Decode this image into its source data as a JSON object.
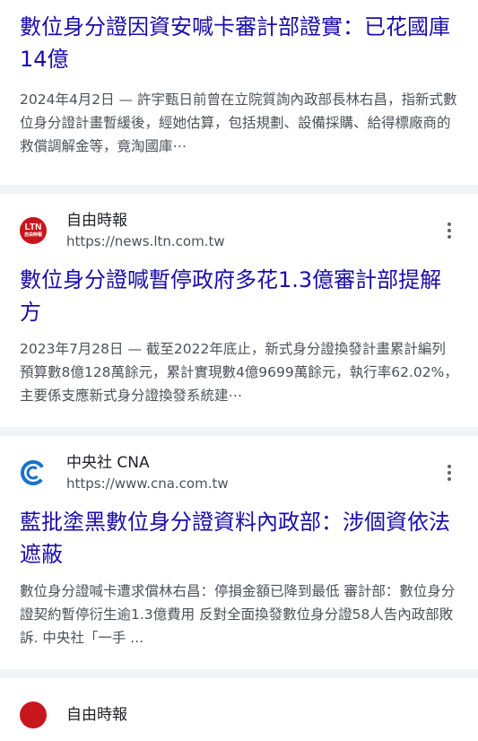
{
  "results": [
    {
      "title": "數位身分證因資安喊卡審計部證實：已花國庫14億",
      "snippet": "2024年4月2日 — 許宇甄日前曾在立院質詢內政部長林右昌，指新式數位身分證計畫暫緩後，經她估算，包括規劃、設備採購、給得標廠商的救償調解金等，竟淘國庫⋯"
    },
    {
      "source_name": "自由時報",
      "source_url": "https://news.ltn.com.tw",
      "favicon_text": "LTN",
      "favicon_sub": "自由時報",
      "title": "數位身分證喊暫停政府多花1.3億審計部提解方",
      "snippet": "2023年7月28日 — 截至2022年底止，新式身分證換發計畫累計編列預算數8億128萬餘元，累計實現數4億9699萬餘元，執行率62.02%，主要係支應新式身分證換發系統建⋯"
    },
    {
      "source_name": "中央社 CNA",
      "source_url": "https://www.cna.com.tw",
      "title": "藍批塗黑數位身分證資料內政部：涉個資依法遮蔽",
      "snippet": "數位身分證喊卡遭求償林右昌：停損金額已降到最低 審計部：數位身分證契約暫停衍生逾1.3億費用 反對全面換發數位身分證58人告內政部敗訴. 中央社「一手 ..."
    },
    {
      "source_name": "自由時報"
    }
  ],
  "colors": {
    "title": "#1a0dab",
    "snippet": "#4d5156",
    "divider": "#f1f3f4",
    "ltn": "#c8161d",
    "cna": "#1a73c9"
  },
  "icons": {
    "more": "more-vert-icon",
    "ltn": "ltn-favicon-icon",
    "cna": "cna-favicon-icon"
  }
}
